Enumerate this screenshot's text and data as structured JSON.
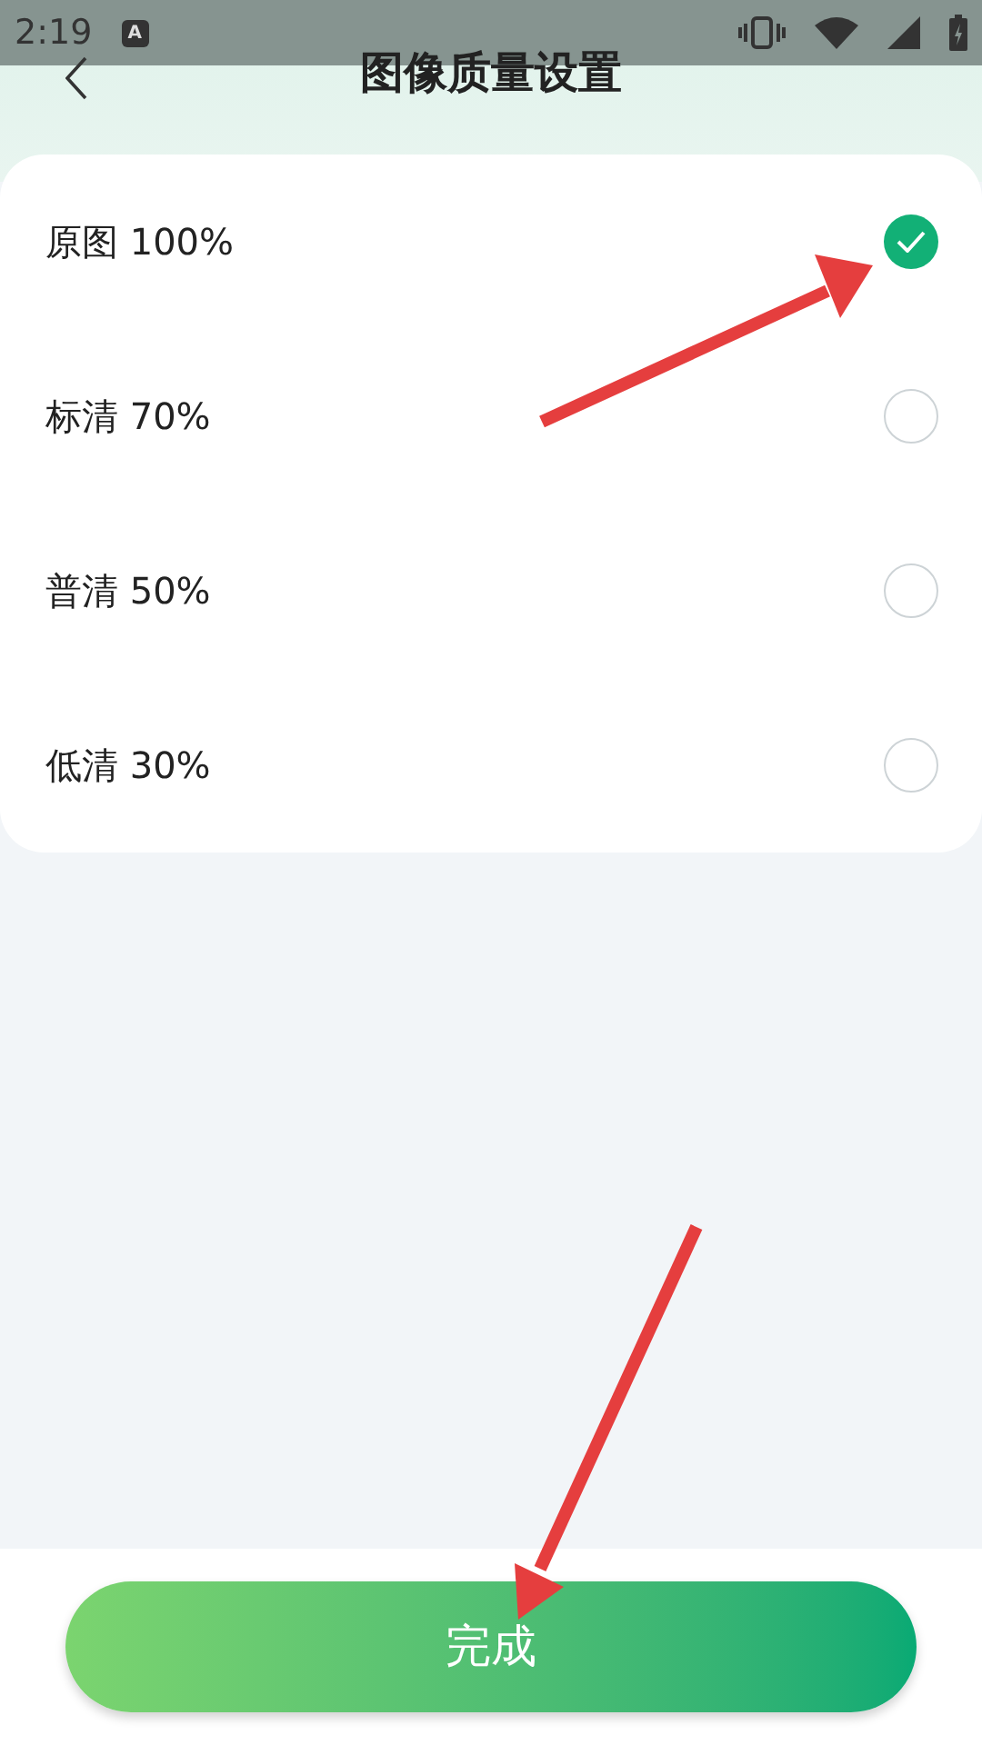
{
  "status_bar": {
    "time": "2:19",
    "notification_badge": "A"
  },
  "header": {
    "title": "图像质量设置"
  },
  "options": [
    {
      "label": "原图 100%",
      "selected": true
    },
    {
      "label": "标清 70%",
      "selected": false
    },
    {
      "label": "普清 50%",
      "selected": false
    },
    {
      "label": "低清 30%",
      "selected": false
    }
  ],
  "done_button": {
    "label": "完成"
  }
}
